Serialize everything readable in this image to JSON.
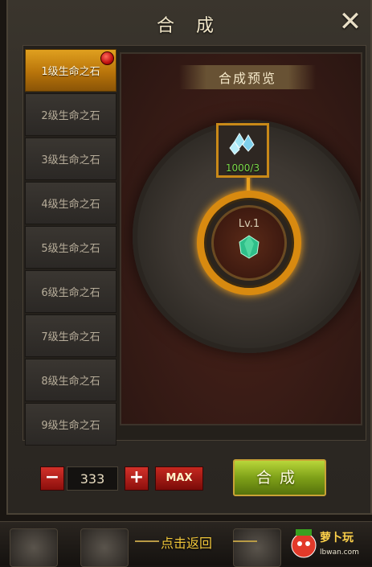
{
  "window": {
    "title": "合 成"
  },
  "tabs": [
    {
      "label": "1级生命之石",
      "active": true,
      "badge": true
    },
    {
      "label": "2级生命之石"
    },
    {
      "label": "3级生命之石"
    },
    {
      "label": "4级生命之石"
    },
    {
      "label": "5级生命之石"
    },
    {
      "label": "6级生命之石"
    },
    {
      "label": "7级生命之石"
    },
    {
      "label": "8级生命之石"
    },
    {
      "label": "9级生命之石"
    }
  ],
  "preview": {
    "title": "合成预览",
    "material_count": "1000/3",
    "result_level": "Lv.1"
  },
  "controls": {
    "minus_label": "−",
    "quantity": "333",
    "plus_label": "+",
    "max_label": "MAX",
    "compose_label": "合成"
  },
  "footer": {
    "return_label": "点击返回",
    "logo_text": "萝卜玩",
    "logo_sub": "lbwan.com"
  },
  "colors": {
    "active_tab": "#d08a12",
    "compose_button": "#8fb020",
    "count_text": "#7ddc4a",
    "return_text": "#f0c63a"
  }
}
